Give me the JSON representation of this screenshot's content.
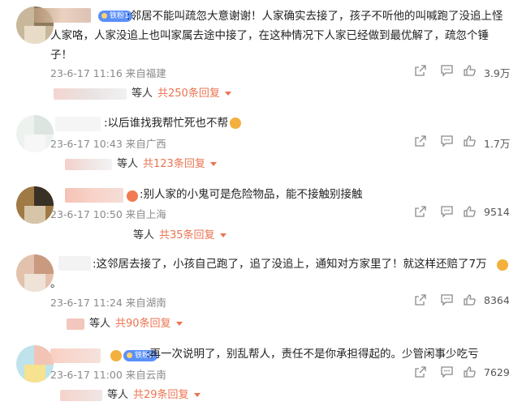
{
  "comments": [
    {
      "badge": "铁粉1",
      "text": ":邻居不能叫疏忽大意谢谢！人家确实去接了，孩子不听他的叫喊跑了没追上怪人家咯，人家没追上也叫家属去途中接了，在这种情况下人家已经做到最优解了，疏忽个锤子！",
      "meta": "23-6-17 11:16 来自福建",
      "likes": "3.9万",
      "reply_prefix": "等人",
      "reply_link": "共250条回复"
    },
    {
      "badge": "",
      "text": ":以后谁找我帮忙死也不帮",
      "meta": "23-6-17 10:43 来自广西",
      "likes": "1.7万",
      "reply_prefix": "等人",
      "reply_link": "共123条回复"
    },
    {
      "badge": "",
      "text": ":别人家的小鬼可是危险物品，能不接触别接触",
      "meta": "23-6-17 10:50 来自上海",
      "likes": "9514",
      "reply_prefix": "等人",
      "reply_link": "共35条回复"
    },
    {
      "badge": "",
      "text": ":这邻居去接了，小孩自己跑了，追了没追上，通知对方家里了！就这样还赔了7万",
      "text2": "。",
      "meta": "23-6-17 11:24 来自湖南",
      "likes": "8364",
      "reply_prefix": "等人",
      "reply_link": "共90条回复"
    },
    {
      "badge": "铁粉2",
      "text": ":再一次说明了，别乱帮人，责任不是你承担得起的。少管闲事少吃亏",
      "meta": "23-6-17 11:00 来自云南",
      "likes": "7629",
      "reply_prefix": "等人",
      "reply_link": "共29条回复"
    }
  ],
  "icons": {
    "share": "share-icon",
    "comment": "comment-icon",
    "like": "thumbs-up-icon"
  },
  "colors": {
    "link": "#eb7350",
    "badge": "#5b8ff9",
    "meta": "#8a8a8a"
  }
}
